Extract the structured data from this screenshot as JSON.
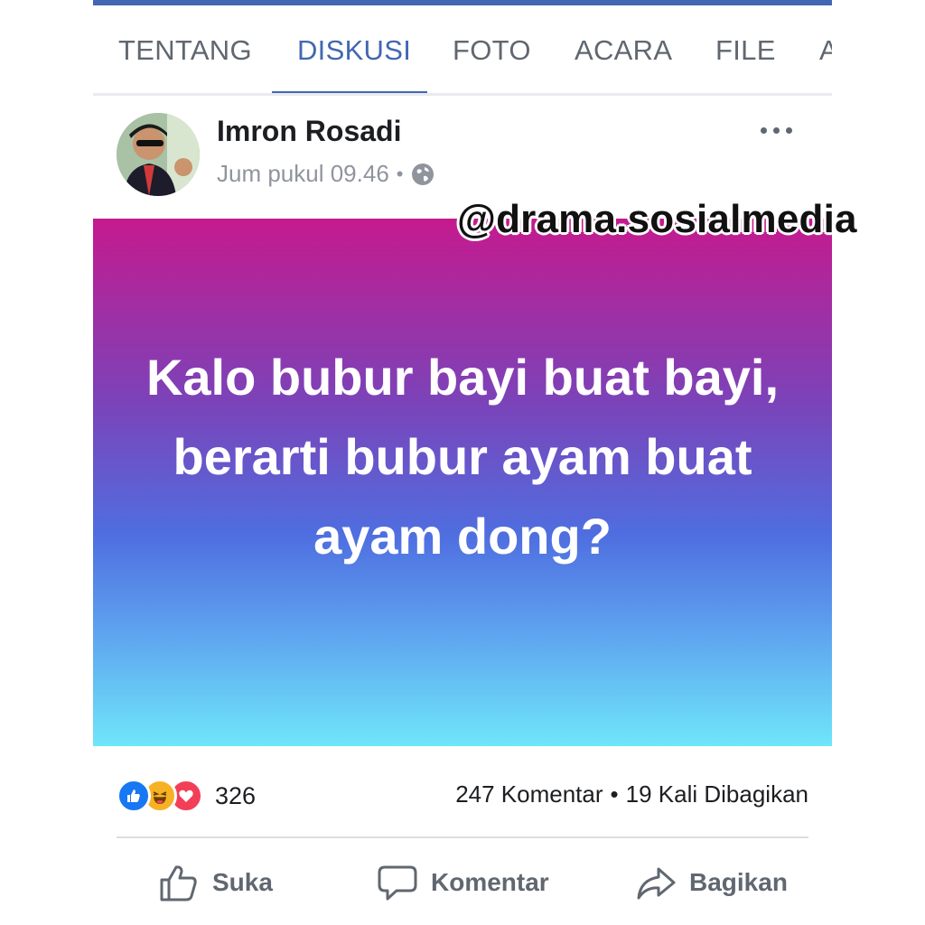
{
  "tabs": [
    {
      "label": "TENTANG",
      "active": false
    },
    {
      "label": "DISKUSI",
      "active": true
    },
    {
      "label": "FOTO",
      "active": false
    },
    {
      "label": "ACARA",
      "active": false
    },
    {
      "label": "FILE",
      "active": false
    },
    {
      "label": "A",
      "active": false
    }
  ],
  "post": {
    "author": "Imron Rosadi",
    "time": "Jum pukul 09.46",
    "separator": "•",
    "privacy_icon": "globe-icon",
    "more_icon": "more-options-icon",
    "status_text": "Kalo bubur bayi buat bayi, berarti bubur ayam buat ayam dong?"
  },
  "watermark": "@drama.sosialmedia",
  "stats": {
    "reaction_icons": [
      "like-icon",
      "haha-icon",
      "love-icon"
    ],
    "reaction_count": "326",
    "comments": "247 Komentar",
    "separator": "•",
    "shares": "19 Kali Dibagikan"
  },
  "actions": {
    "like_label": "Suka",
    "comment_label": "Komentar",
    "share_label": "Bagikan"
  },
  "colors": {
    "accent": "#4267b2",
    "gradient_top": "#c51a8e",
    "gradient_bottom": "#6fe6f9"
  }
}
